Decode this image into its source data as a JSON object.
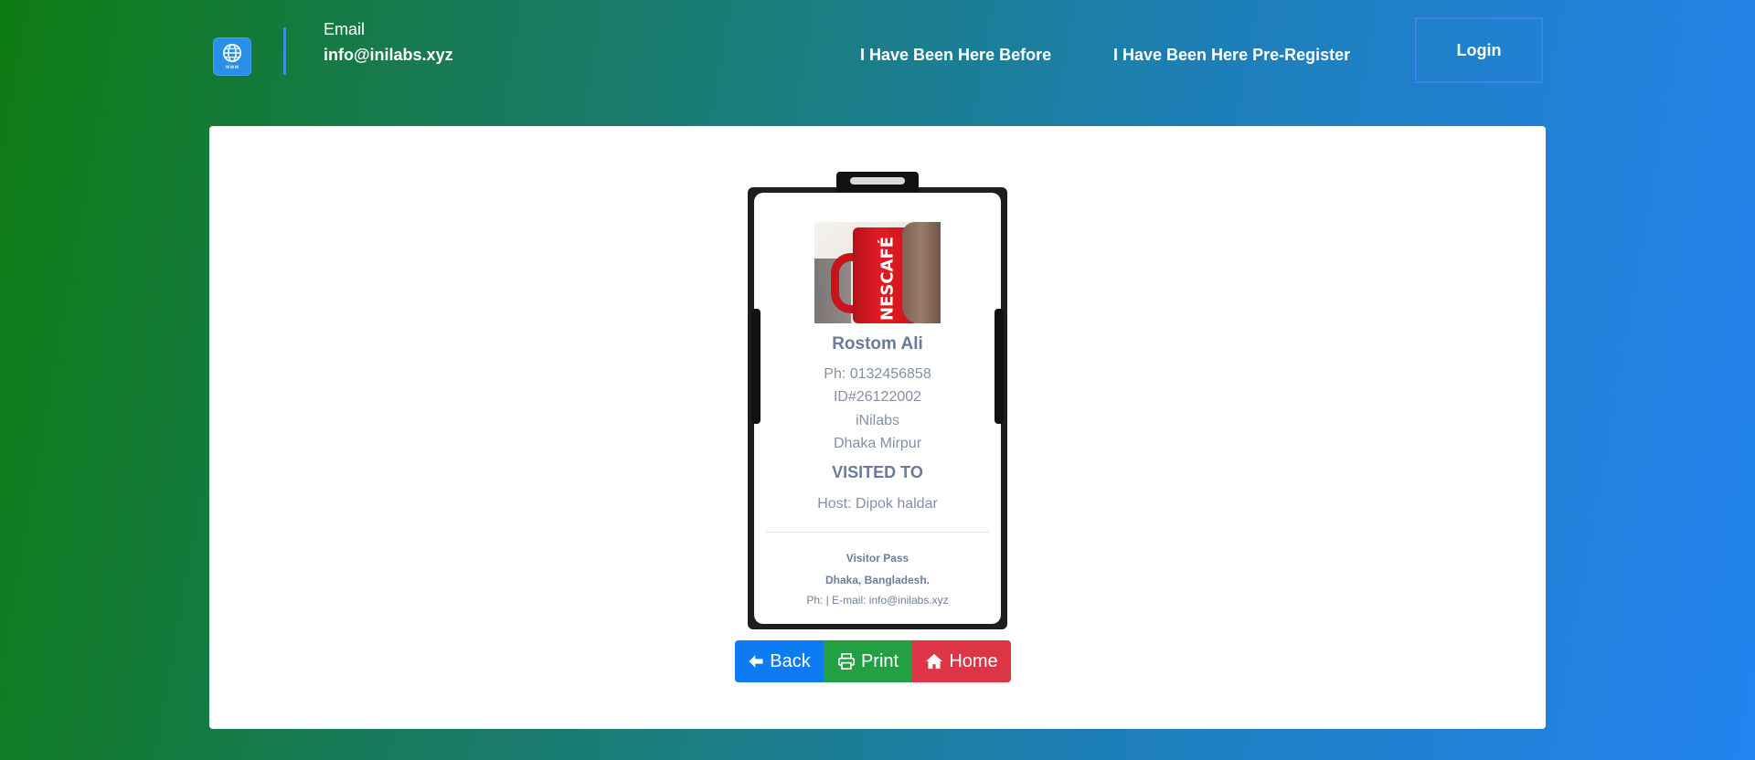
{
  "header": {
    "logo": {
      "icon": "globe-www-icon",
      "caption": "www"
    },
    "email_label": "Email",
    "email_value": "info@inilabs.xyz",
    "nav": [
      {
        "label": "I Have Been Here Before"
      },
      {
        "label": "I Have Been Here Pre-Register"
      }
    ],
    "login_label": "Login"
  },
  "badge": {
    "photo_text": "NESCAFÉ",
    "name": "Rostom Ali",
    "phone": "Ph: 0132456858",
    "id": "ID#26122002",
    "organization": "iNilabs",
    "address": "Dhaka Mirpur",
    "visited_heading": "VISITED TO",
    "host": "Host: Dipok haldar",
    "footer": {
      "title": "Visitor Pass",
      "location": "Dhaka, Bangladesh.",
      "contact": "Ph: | E-mail: info@inilabs.xyz"
    }
  },
  "actions": {
    "back": {
      "label": "Back",
      "icon": "arrow-left-icon",
      "color": "#0d7cf2"
    },
    "print": {
      "label": "Print",
      "icon": "printer-icon",
      "color": "#23a044"
    },
    "home": {
      "label": "Home",
      "icon": "home-icon",
      "color": "#dc3545"
    }
  }
}
